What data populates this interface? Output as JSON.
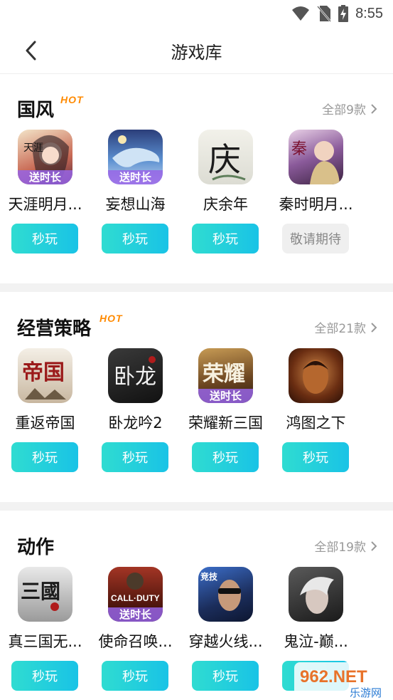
{
  "status": {
    "time": "8:55"
  },
  "header": {
    "title": "游戏库"
  },
  "sections": [
    {
      "title": "国风",
      "hot": "HOT",
      "all": "全部9款",
      "games": [
        {
          "name": "天涯明月...",
          "badge": "送时长",
          "button": "秒玩",
          "enabled": true
        },
        {
          "name": "妄想山海",
          "badge": "送时长",
          "button": "秒玩",
          "enabled": true
        },
        {
          "name": "庆余年",
          "badge": "",
          "button": "秒玩",
          "enabled": true
        },
        {
          "name": "秦时明月...",
          "badge": "",
          "button": "敬请期待",
          "enabled": false
        }
      ]
    },
    {
      "title": "经营策略",
      "hot": "HOT",
      "all": "全部21款",
      "games": [
        {
          "name": "重返帝国",
          "badge": "",
          "button": "秒玩",
          "enabled": true
        },
        {
          "name": "卧龙吟2",
          "badge": "",
          "button": "秒玩",
          "enabled": true
        },
        {
          "name": "荣耀新三国",
          "badge": "送时长",
          "button": "秒玩",
          "enabled": true
        },
        {
          "name": "鸿图之下",
          "badge": "",
          "button": "秒玩",
          "enabled": true
        }
      ]
    },
    {
      "title": "动作",
      "hot": "",
      "all": "全部19款",
      "games": [
        {
          "name": "真三国无...",
          "badge": "",
          "button": "秒玩",
          "enabled": true
        },
        {
          "name": "使命召唤...",
          "badge": "送时长",
          "button": "秒玩",
          "enabled": true
        },
        {
          "name": "穿越火线...",
          "badge": "",
          "button": "秒玩",
          "enabled": true
        },
        {
          "name": "鬼泣-巅...",
          "badge": "",
          "button": "秒玩",
          "enabled": true
        }
      ]
    }
  ],
  "icon_art": {
    "s0g0": "天涯",
    "s0g1": "",
    "s0g2": "庆",
    "s0g3": "秦",
    "s1g0": "帝国",
    "s1g1": "卧龙",
    "s1g2": "荣耀",
    "s1g3": "",
    "s2g0": "三國",
    "s2g1": "CALL·DUTY",
    "s2g2": "竞技",
    "s2g3": ""
  },
  "watermark": {
    "top": "962.NET",
    "bottom": "乐游网"
  }
}
